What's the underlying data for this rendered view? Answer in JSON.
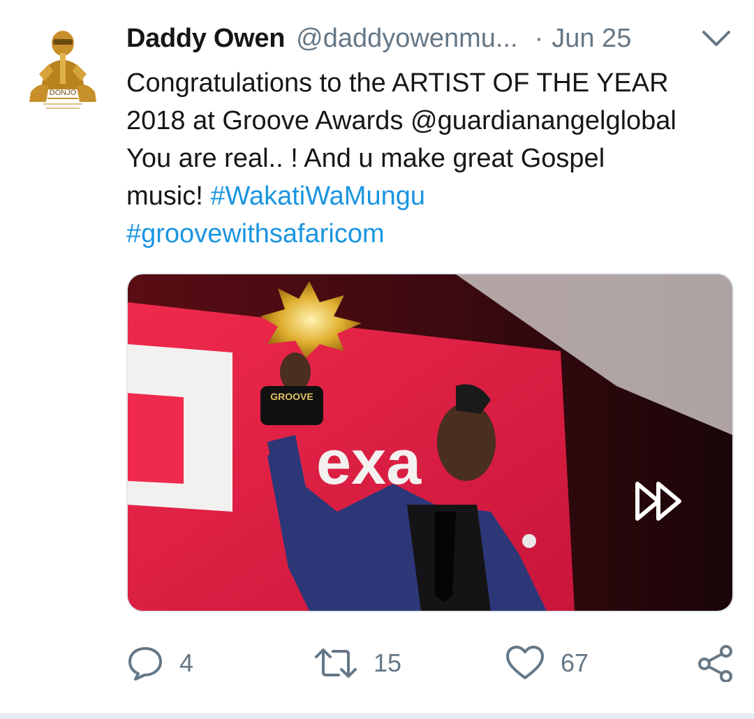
{
  "tweet": {
    "display_name": "Daddy Owen",
    "handle": "@daddyowenmu...",
    "separator": "·",
    "date": "Jun 25",
    "avatar": {
      "icon": "avatar-donjo",
      "text": "DONJO"
    },
    "text_lines": [
      [
        {
          "t": "Congratulations to the ARTIST OF THE YEAR",
          "link": false
        }
      ],
      [
        {
          "t": "2018 at Groove Awards @guardianangelglobal",
          "link": false
        }
      ],
      [
        {
          "t": "You are real.. ! And u make great Gospel",
          "link": false
        }
      ],
      [
        {
          "t": "music! ",
          "link": false
        },
        {
          "t": "#WakatiWaMungu",
          "link": true
        }
      ],
      [
        {
          "t": "#groovewithsafaricom",
          "link": true
        }
      ]
    ],
    "media": {
      "description_icon": "photo",
      "trophy_label": "GROOVE",
      "screen_text": "exa"
    },
    "actions": {
      "reply": {
        "icon": "reply-icon",
        "count": "4"
      },
      "retweet": {
        "icon": "retweet-icon",
        "count": "15"
      },
      "like": {
        "icon": "heart-icon",
        "count": "67"
      },
      "share": {
        "icon": "share-icon"
      }
    }
  },
  "colors": {
    "link": "#1b95e0",
    "secondary_text": "#657786",
    "primary_text": "#14171a",
    "icon": "#657786"
  }
}
